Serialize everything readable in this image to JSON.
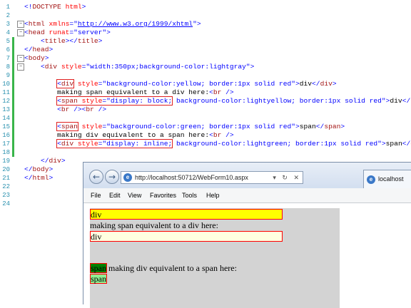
{
  "editor": {
    "lines": [
      {
        "n": "1",
        "parts": [
          [
            "c-blue",
            "<!"
          ],
          [
            "c-maroon",
            "DOCTYPE"
          ],
          [
            "c-red",
            " html"
          ],
          [
            "c-blue",
            ">"
          ]
        ]
      },
      {
        "n": "2",
        "parts": []
      },
      {
        "n": "3",
        "parts": [
          [
            "c-blue",
            "<"
          ],
          [
            "c-maroon",
            "html"
          ],
          [
            "c-red",
            " xmlns"
          ],
          [
            "c-blue",
            "=\""
          ],
          [
            "c-link",
            "http://www.w3.org/1999/xhtml"
          ],
          [
            "c-blue",
            "\">"
          ]
        ]
      },
      {
        "n": "4",
        "parts": [
          [
            "c-blue",
            "<"
          ],
          [
            "c-maroon",
            "head"
          ],
          [
            "c-red",
            " runat"
          ],
          [
            "c-blue",
            "=\"server\">"
          ]
        ]
      },
      {
        "n": "5",
        "parts": [
          [
            "c-text",
            "    "
          ],
          [
            "c-blue",
            "<"
          ],
          [
            "c-maroon",
            "title"
          ],
          [
            "c-blue",
            "></"
          ],
          [
            "c-maroon",
            "title"
          ],
          [
            "c-blue",
            ">"
          ]
        ]
      },
      {
        "n": "6",
        "parts": [
          [
            "c-blue",
            "</"
          ],
          [
            "c-maroon",
            "head"
          ],
          [
            "c-blue",
            ">"
          ]
        ]
      },
      {
        "n": "7",
        "parts": [
          [
            "c-blue",
            "<"
          ],
          [
            "c-maroon",
            "body"
          ],
          [
            "c-blue",
            ">"
          ]
        ]
      },
      {
        "n": "8",
        "parts": [
          [
            "c-text",
            "    "
          ],
          [
            "c-blue",
            "<"
          ],
          [
            "c-maroon",
            "div"
          ],
          [
            "c-red",
            " style"
          ],
          [
            "c-blue",
            "=\"width:350px;background-color:lightgray\">"
          ]
        ]
      },
      {
        "n": "9",
        "parts": []
      },
      {
        "n": "10",
        "parts": [
          [
            "c-text",
            "        "
          ],
          [
            "c-blue box",
            "<"
          ],
          [
            "c-maroon box",
            "div"
          ],
          [
            "c-red",
            " style"
          ],
          [
            "c-blue",
            "=\"background-color:yellow; border:1px solid red\">"
          ],
          [
            "c-text",
            "div"
          ],
          [
            "c-blue",
            "</"
          ],
          [
            "c-maroon",
            "div"
          ],
          [
            "c-blue",
            ">"
          ]
        ]
      },
      {
        "n": "11",
        "parts": [
          [
            "c-text",
            "        making span equivalent to a div here:"
          ],
          [
            "c-blue",
            "<"
          ],
          [
            "c-maroon",
            "br"
          ],
          [
            "c-blue",
            " />"
          ]
        ]
      },
      {
        "n": "12",
        "parts": [
          [
            "c-text",
            "        "
          ],
          [
            "c-blue box",
            "<"
          ],
          [
            "c-maroon box",
            "span"
          ],
          [
            "c-red box",
            " style"
          ],
          [
            "c-blue box",
            "=\"display: block;"
          ],
          [
            "c-blue",
            " background-color:lightyellow; border:1px solid red\">"
          ],
          [
            "c-text",
            "div"
          ],
          [
            "c-blue",
            "</"
          ],
          [
            "c-maroon",
            "span"
          ],
          [
            "c-blue",
            ">"
          ]
        ]
      },
      {
        "n": "13",
        "parts": [
          [
            "c-text",
            "        "
          ],
          [
            "c-blue",
            "<"
          ],
          [
            "c-maroon",
            "br"
          ],
          [
            "c-blue",
            " /><"
          ],
          [
            "c-maroon",
            "br"
          ],
          [
            "c-blue",
            " />"
          ]
        ]
      },
      {
        "n": "14",
        "parts": []
      },
      {
        "n": "15",
        "parts": [
          [
            "c-text",
            "        "
          ],
          [
            "c-blue box",
            "<"
          ],
          [
            "c-maroon box",
            "span"
          ],
          [
            "c-red",
            " style"
          ],
          [
            "c-blue",
            "=\"background-color:green; border:1px solid red\">"
          ],
          [
            "c-text",
            "span"
          ],
          [
            "c-blue",
            "</"
          ],
          [
            "c-maroon",
            "span"
          ],
          [
            "c-blue",
            ">"
          ]
        ]
      },
      {
        "n": "16",
        "parts": [
          [
            "c-text",
            "        making div equivalent to a span here:"
          ],
          [
            "c-blue",
            "<"
          ],
          [
            "c-maroon",
            "br"
          ],
          [
            "c-blue",
            " />"
          ]
        ]
      },
      {
        "n": "17",
        "parts": [
          [
            "c-text",
            "        "
          ],
          [
            "c-blue box",
            "<"
          ],
          [
            "c-maroon box",
            "div"
          ],
          [
            "c-red box",
            " style"
          ],
          [
            "c-blue box",
            "=\"display: inline;"
          ],
          [
            "c-blue",
            " background-color:lightgreen; border:1px solid red\">"
          ],
          [
            "c-text",
            "span"
          ],
          [
            "c-blue",
            "</"
          ],
          [
            "c-maroon",
            "div"
          ],
          [
            "c-blue",
            ">"
          ]
        ]
      },
      {
        "n": "18",
        "parts": []
      },
      {
        "n": "19",
        "parts": [
          [
            "c-text",
            "    "
          ],
          [
            "c-blue",
            "</"
          ],
          [
            "c-maroon",
            "div"
          ],
          [
            "c-blue",
            ">"
          ]
        ]
      },
      {
        "n": "20",
        "parts": [
          [
            "c-blue",
            "</"
          ],
          [
            "c-maroon",
            "body"
          ],
          [
            "c-blue",
            ">"
          ]
        ]
      },
      {
        "n": "21",
        "parts": [
          [
            "c-blue",
            "</"
          ],
          [
            "c-maroon",
            "html"
          ],
          [
            "c-blue",
            ">"
          ]
        ]
      },
      {
        "n": "22",
        "parts": []
      },
      {
        "n": "23",
        "parts": []
      },
      {
        "n": "24",
        "parts": []
      }
    ],
    "line_numbers": [
      "3",
      "4",
      "5",
      "6",
      "7",
      "8",
      "9",
      "10",
      "11",
      "12",
      "13",
      "14",
      "15",
      "16",
      "17",
      "18",
      "19",
      "20",
      "21",
      "22",
      "23",
      "24"
    ]
  },
  "browser": {
    "back_icon": "back-arrow-icon",
    "forward_icon": "forward-arrow-icon",
    "url": "http://localhost:50712/WebForm10.aspx",
    "address_tools": "▾ ↻ ✕",
    "tab_title": "localhost",
    "menu": [
      "File",
      "Edit",
      "View",
      "Favorites",
      "Tools",
      "Help"
    ],
    "page": {
      "yellow_div_text": "div",
      "line1_text": "making span equivalent to a div here:",
      "block_span_text": "div",
      "green_span_text": "span",
      "line2_text": "making div equivalent to a span here:",
      "inline_div_text": "span"
    }
  }
}
